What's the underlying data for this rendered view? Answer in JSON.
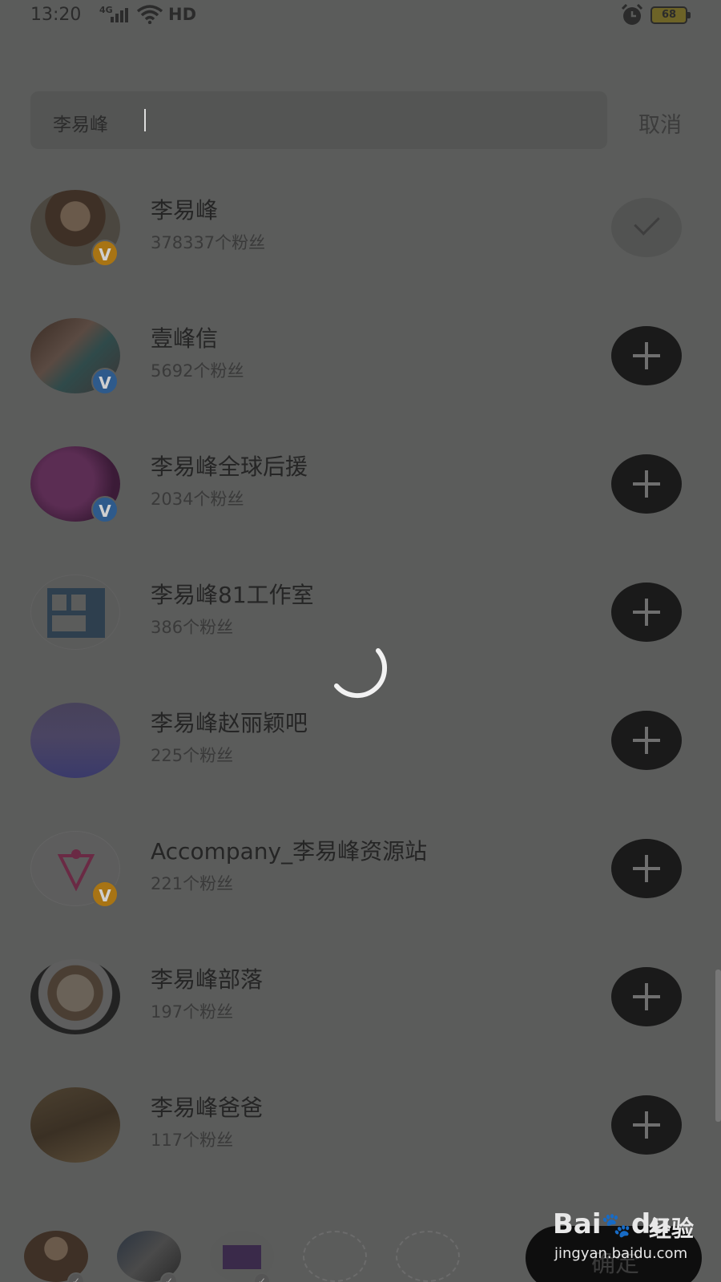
{
  "status_bar": {
    "time": "13:20",
    "network": "4G",
    "hd": "HD",
    "battery": "68"
  },
  "search": {
    "value": "李易峰",
    "cancel_label": "取消"
  },
  "results": [
    {
      "name": "李易峰",
      "fans": "378337个粉丝",
      "verified": "V",
      "badge_color": "gold",
      "followed": true
    },
    {
      "name": "壹峰信",
      "fans": "5692个粉丝",
      "verified": "V",
      "badge_color": "blue",
      "followed": false
    },
    {
      "name": "李易峰全球后援",
      "fans": "2034个粉丝",
      "verified": "V",
      "badge_color": "blue",
      "followed": false
    },
    {
      "name": "李易峰81工作室",
      "fans": "386个粉丝",
      "verified": "",
      "badge_color": "",
      "followed": false
    },
    {
      "name": "李易峰赵丽颖吧",
      "fans": "225个粉丝",
      "verified": "",
      "badge_color": "",
      "followed": false
    },
    {
      "name": "Accompany_李易峰资源站",
      "fans": "221个粉丝",
      "verified": "V",
      "badge_color": "gold",
      "followed": false
    },
    {
      "name": "李易峰部落",
      "fans": "197个粉丝",
      "verified": "",
      "badge_color": "",
      "followed": false
    },
    {
      "name": "李易峰爸爸",
      "fans": "117个粉丝",
      "verified": "",
      "badge_color": "",
      "followed": false
    }
  ],
  "bottom_bar": {
    "confirm_label": "确定"
  },
  "watermark": {
    "logo": "Bai",
    "logo2": "du",
    "cn": "经验",
    "url": "jingyan.baidu.com"
  },
  "colors": {
    "overlay_bg": "#5b5c5b",
    "add_button": "#1a1a1a",
    "badge_gold": "#a87414",
    "badge_blue": "#2e5a8b"
  }
}
